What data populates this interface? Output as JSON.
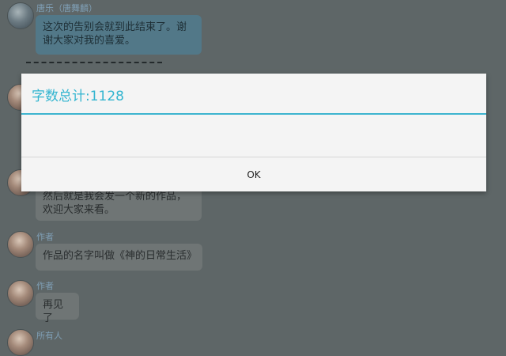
{
  "dialog": {
    "title": "字数总计:1128",
    "ok_label": "OK",
    "accent_color": "#33b5d0"
  },
  "chat": {
    "messages": [
      {
        "sender": "唐乐（唐舞麟）",
        "text": "这次的告别会就到此结束了。谢谢大家对我的喜爱。",
        "style": "blue"
      },
      {
        "sender": "",
        "text": "然后就是我会发一个新的作品，欢迎大家来看。",
        "style": "gray"
      },
      {
        "sender": "作者",
        "text": "作品的名字叫做《神的日常生活》",
        "style": "gray"
      },
      {
        "sender": "作者",
        "text": "再见了",
        "style": "gray"
      },
      {
        "sender": "所有人",
        "text": "",
        "style": "gray"
      }
    ],
    "separator": "--------------------"
  }
}
